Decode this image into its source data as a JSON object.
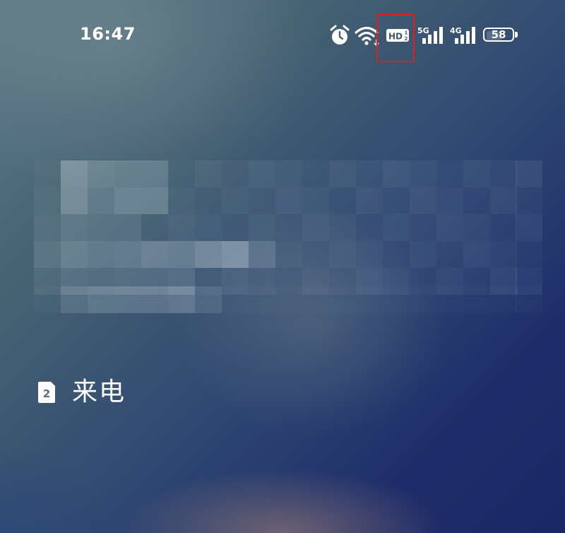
{
  "status_bar": {
    "time": "16:47",
    "icons": [
      "alarm-icon",
      "wifi-icon",
      "hd-voice-sim2-icon",
      "5g-signal-icon",
      "4g-signal-icon",
      "battery-icon"
    ],
    "hd_label": "HD",
    "hd_sim_number": "2",
    "network_1": "5G",
    "network_2": "4G",
    "battery_level": "58"
  },
  "incoming_call": {
    "sim_number": "2",
    "label": "来电",
    "caller_info": "pixelated (obscured)"
  },
  "colors": {
    "highlight_box": "#e01e1e",
    "text": "#ffffff"
  }
}
